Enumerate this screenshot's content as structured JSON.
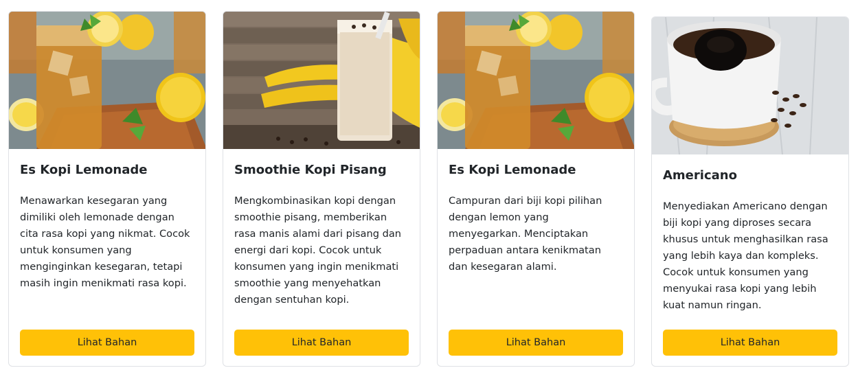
{
  "cards": [
    {
      "title": "Es Kopi Lemonade",
      "description": "Menawarkan kesegaran yang dimiliki oleh lemonade dengan cita rasa kopi yang nikmat. Cocok untuk konsumen yang menginginkan kesegaran, tetapi masih ingin menikmati rasa kopi.",
      "button_label": "Lihat Bahan",
      "image": "iced-coffee-lemonade-image"
    },
    {
      "title": "Smoothie Kopi Pisang",
      "description": "Mengkombinasikan kopi dengan smoothie pisang, memberikan rasa manis alami dari pisang dan energi dari kopi. Cocok untuk konsumen yang ingin menikmati smoothie yang menyehatkan dengan sentuhan kopi.",
      "button_label": "Lihat Bahan",
      "image": "banana-coffee-smoothie-image"
    },
    {
      "title": "Es Kopi Lemonade",
      "description": "Campuran dari biji kopi pilihan dengan lemon yang menyegarkan. Menciptakan perpaduan antara kenikmatan dan kesegaran alami.",
      "button_label": "Lihat Bahan",
      "image": "iced-coffee-lemonade-image"
    },
    {
      "title": "Americano",
      "description": "Menyediakan Americano dengan biji kopi yang diproses secara khusus untuk menghasilkan rasa yang lebih kaya dan kompleks. Cocok untuk konsumen yang menyukai rasa kopi yang lebih kuat namun ringan.",
      "button_label": "Lihat Bahan",
      "image": "americano-cup-image"
    }
  ],
  "colors": {
    "button": "#ffc107",
    "border": "#dfe1e5",
    "text": "#212529"
  }
}
